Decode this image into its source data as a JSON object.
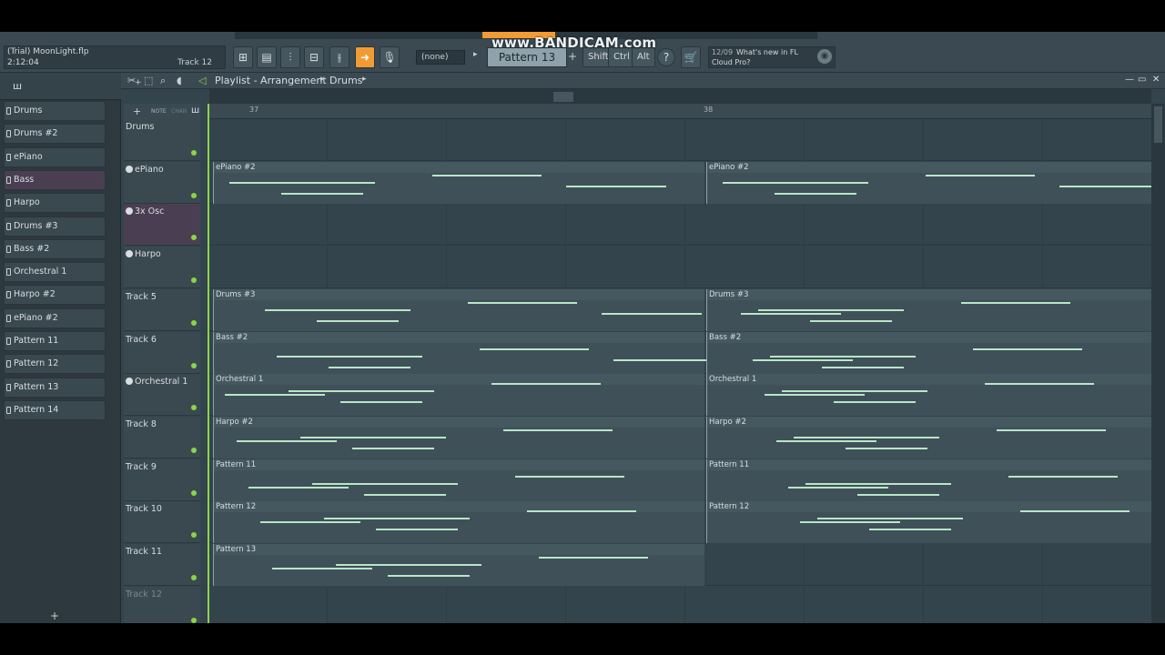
{
  "topbar": {
    "project_name": "(Trial) MoonLight.flp",
    "project_time": "2:12:04",
    "track_label": "Track 12",
    "pattern_none": "(none)",
    "pattern_selected": "Pattern 13",
    "pattern_add": "+",
    "keys": [
      "Shift",
      "Ctrl",
      "Alt"
    ],
    "news_date": "12/09",
    "news_line1": "What's new in FL",
    "news_line2": "Cloud Pro?",
    "watermark": "www.BANDICAM.com"
  },
  "playlist": {
    "title": "Playlist - Arrangement",
    "crumb": "Drums",
    "ruler": [
      "37",
      "38"
    ]
  },
  "browser": {
    "items": [
      "Drums",
      "Drums #2",
      "ePiano",
      "Bass",
      "Harpo",
      "Drums #3",
      "Bass #2",
      "Orchestral 1",
      "Harpo #2",
      "ePiano #2",
      "Pattern 11",
      "Pattern 12",
      "Pattern 13",
      "Pattern 14"
    ],
    "add": "+"
  },
  "tracks": [
    {
      "name": "Drums",
      "clips": []
    },
    {
      "name": "ePiano",
      "clips": [
        "ePiano #2",
        "ePiano #2"
      ]
    },
    {
      "name": "3x Osc",
      "clips": []
    },
    {
      "name": "Harpo",
      "clips": []
    },
    {
      "name": "Track 5",
      "clips": [
        "Drums #3",
        "Drums #3"
      ]
    },
    {
      "name": "Track 6",
      "clips": [
        "Bass #2",
        "Bass #2"
      ]
    },
    {
      "name": "Orchestral 1",
      "clips": [
        "Orchestral 1",
        "Orchestral 1"
      ]
    },
    {
      "name": "Track 8",
      "clips": [
        "Harpo #2",
        "Harpo #2"
      ]
    },
    {
      "name": "Track 9",
      "clips": [
        "Pattern 11",
        "Pattern 11"
      ]
    },
    {
      "name": "Track 10",
      "clips": [
        "Pattern 12",
        "Pattern 12"
      ]
    },
    {
      "name": "Track 11",
      "clips": [
        "Pattern 13"
      ]
    },
    {
      "name": "Track 12",
      "clips": []
    }
  ],
  "icons": [
    "play-icon",
    "magnet-icon",
    "pencil-icon",
    "brush-icon",
    "delete-icon",
    "mute-icon",
    "slip-icon",
    "slice-icon",
    "select-icon",
    "zoom-icon",
    "speaker-icon"
  ],
  "colors": {
    "accent": "#f29b33",
    "note": "#b9e6c8",
    "lane": "#34444c",
    "led": "#8bd44a"
  }
}
